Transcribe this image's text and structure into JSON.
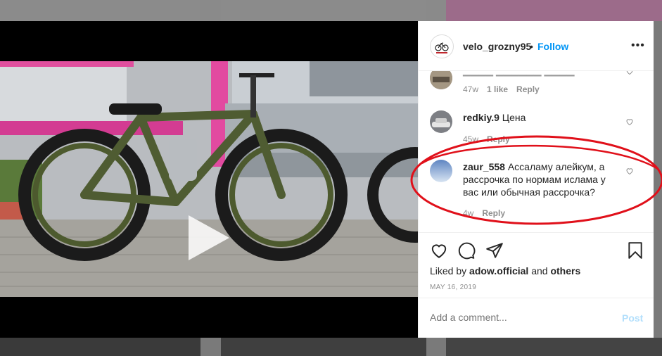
{
  "header": {
    "username": "velo_grozny95",
    "separator": "•",
    "follow_label": "Follow",
    "more_icon": "more-horizontal-icon"
  },
  "comments": [
    {
      "username": "",
      "text": "",
      "time": "47w",
      "likes": "1 like",
      "reply": "Reply"
    },
    {
      "username": "redkiy.9",
      "text": "Цена",
      "time": "45w",
      "reply": "Reply"
    },
    {
      "username": "zaur_558",
      "text_line1": "Ассаламу алейкум, а",
      "text_line2": "рассрочка по нормам ислама у",
      "text_line3": "вас или обычная рассрочка?",
      "time": "4w",
      "reply": "Reply"
    }
  ],
  "actions": {
    "liked_by_prefix": "Liked by",
    "liked_by_user": "adow.official",
    "liked_by_and": "and",
    "liked_by_others": "others",
    "date": "MAY 16, 2019"
  },
  "add_comment": {
    "placeholder": "Add a comment...",
    "post_label": "Post"
  },
  "colors": {
    "link_blue": "#0095f6",
    "post_disabled": "#b2dffc",
    "annotation_red": "#e0101a"
  }
}
